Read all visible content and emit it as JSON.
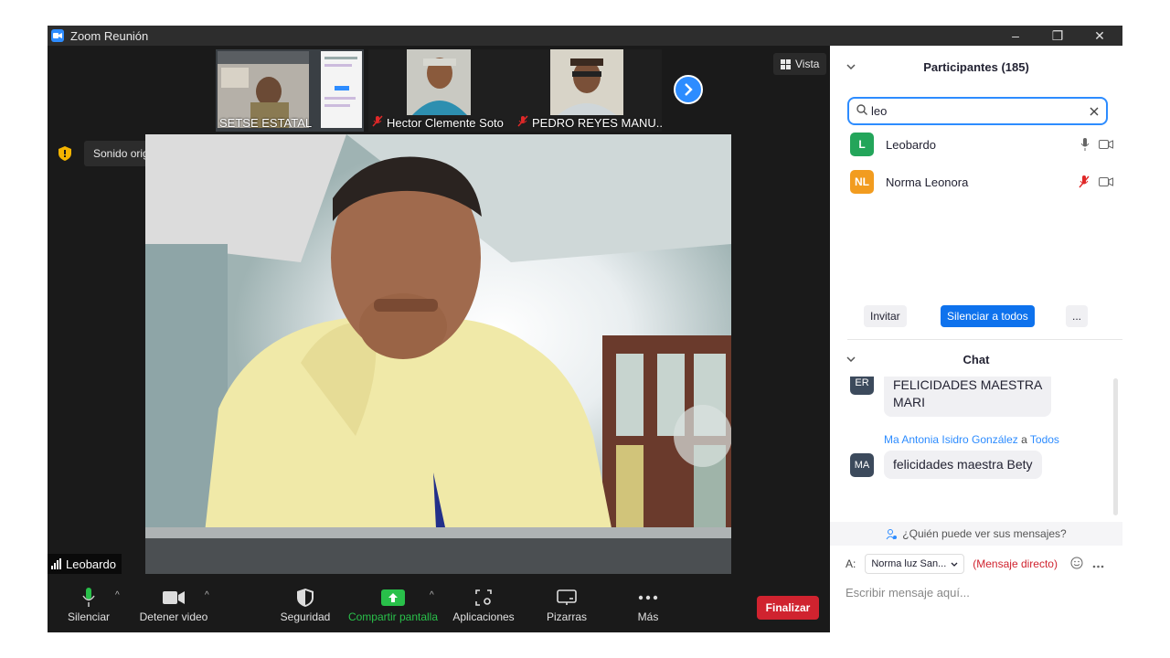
{
  "window": {
    "title": "Zoom Reunión",
    "controls": {
      "minimize": "–",
      "restore": "❐",
      "close": "✕"
    }
  },
  "video": {
    "thumbnails": [
      {
        "name": "SETSE ESTATAL",
        "muted": false
      },
      {
        "name": "Hector Clemente Soto",
        "muted": true
      },
      {
        "name": "PEDRO REYES MANU...",
        "muted": true
      }
    ],
    "view_label": "Vista",
    "original_sound": "Sonido original: desactivado",
    "active_speaker": "Leobardo"
  },
  "toolbar": {
    "mute": "Silenciar",
    "stop_video": "Detener video",
    "security": "Seguridad",
    "share_screen": "Compartir pantalla",
    "apps": "Aplicaciones",
    "whiteboards": "Pizarras",
    "more": "Más",
    "end": "Finalizar"
  },
  "participants": {
    "title": "Participantes (185)",
    "search_value": "leo",
    "list": [
      {
        "initials": "L",
        "name": "Leobardo",
        "color": "#23a55a",
        "mic_muted": false
      },
      {
        "initials": "NL",
        "name": "Norma Leonora",
        "color": "#f29c1f",
        "mic_muted": true
      }
    ],
    "invite": "Invitar",
    "mute_all": "Silenciar a todos",
    "more": "..."
  },
  "chat": {
    "title": "Chat",
    "messages": [
      {
        "initials": "ER",
        "line1": "FELICIDADES MAESTRA",
        "line2": "MARI"
      },
      {
        "initials": "MA",
        "sender": "Ma Antonia Isidro González",
        "to_word": "a",
        "to": "Todos",
        "text": "felicidades maestra Bety"
      }
    ],
    "who_can_see": "¿Quién puede ver sus mensajes?",
    "to_label": "A:",
    "recipient": "Norma luz San...",
    "direct": "(Mensaje directo)",
    "compose_placeholder": "Escribir mensaje aquí..."
  }
}
